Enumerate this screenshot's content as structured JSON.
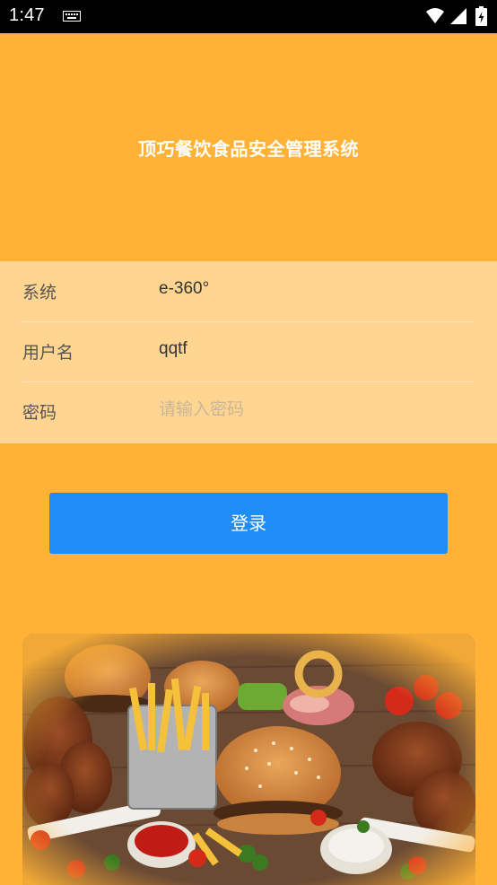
{
  "status_bar": {
    "time": "1:47",
    "icons": [
      "keyboard-icon",
      "wifi-icon",
      "signal-icon",
      "battery-icon"
    ]
  },
  "app": {
    "title": "顶巧餐饮食品安全管理系统"
  },
  "form": {
    "system": {
      "label": "系统",
      "value": "e-360°"
    },
    "username": {
      "label": "用户名",
      "value": "qqtf"
    },
    "password": {
      "label": "密码",
      "value": "",
      "placeholder": "请输入密码"
    }
  },
  "login": {
    "label": "登录"
  },
  "colors": {
    "background": "#FFB236",
    "form_panel": "#FFD591",
    "button": "#1E8DF7",
    "status_bar": "#000000"
  },
  "image": {
    "semantic": "food-banner-image"
  }
}
